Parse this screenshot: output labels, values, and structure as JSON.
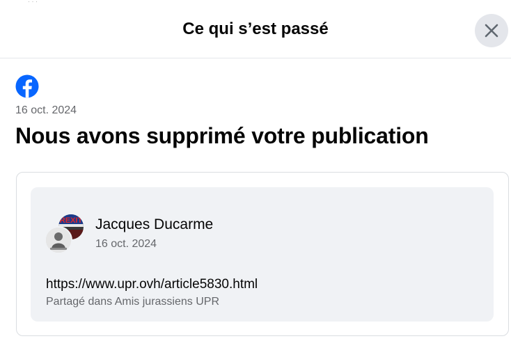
{
  "header": {
    "title": "Ce qui s’est passé",
    "close_icon": "close-icon"
  },
  "notice": {
    "logo_icon": "facebook-logo-icon",
    "brand_color": "#0866ff",
    "date": "16 oct. 2024",
    "headline": "Nous avons supprimé votre publication"
  },
  "post": {
    "author": "Jacques Ducarme",
    "date": "16 oct. 2024",
    "link": "https://www.upr.ovh/article5830.html",
    "shared_in": "Partagé dans Amis jurassiens UPR",
    "group_avatar_logo": "REXIT"
  }
}
